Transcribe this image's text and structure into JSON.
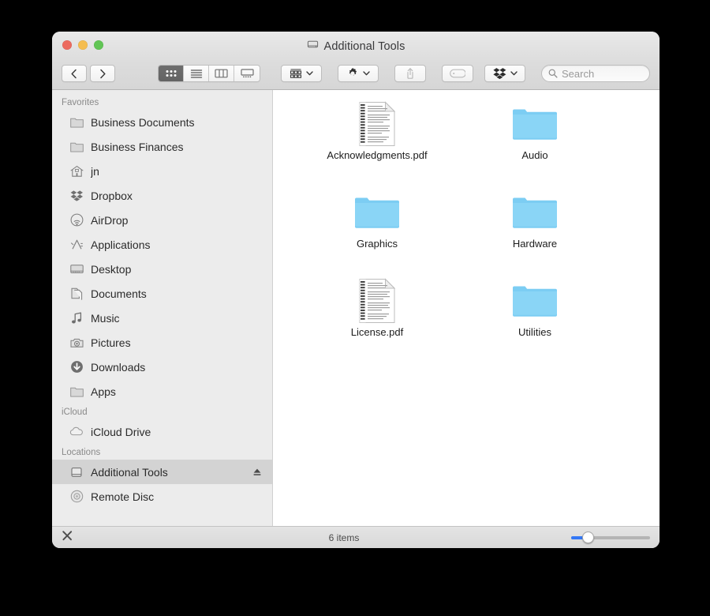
{
  "window": {
    "title": "Additional Tools",
    "title_icon": "external-drive-icon",
    "traffic_lights": {
      "close_label": "Close",
      "minimize_label": "Minimize",
      "zoom_label": "Zoom",
      "close_color": "#ec6a5f",
      "minimize_color": "#f4bd50",
      "zoom_color": "#61c555"
    }
  },
  "toolbar": {
    "back_label": "Back",
    "forward_label": "Forward",
    "view_modes": [
      {
        "name": "icon-view",
        "label": "Icon View",
        "active": true
      },
      {
        "name": "list-view",
        "label": "List View",
        "active": false
      },
      {
        "name": "column-view",
        "label": "Column View",
        "active": false
      },
      {
        "name": "gallery-view",
        "label": "Gallery View",
        "active": false
      }
    ],
    "arrange_label": "Arrange",
    "action_label": "Action",
    "share_label": "Share",
    "tags_label": "Edit Tags",
    "dropbox_label": "Dropbox",
    "search": {
      "placeholder": "Search",
      "value": ""
    }
  },
  "sidebar": {
    "sections": [
      {
        "header": "Favorites",
        "items": [
          {
            "label": "Business Documents",
            "icon": "folder-icon",
            "selected": false,
            "eject": false
          },
          {
            "label": "Business Finances",
            "icon": "folder-icon",
            "selected": false,
            "eject": false
          },
          {
            "label": "jn",
            "icon": "home-icon",
            "selected": false,
            "eject": false
          },
          {
            "label": "Dropbox",
            "icon": "dropbox-icon",
            "selected": false,
            "eject": false
          },
          {
            "label": "AirDrop",
            "icon": "airdrop-icon",
            "selected": false,
            "eject": false
          },
          {
            "label": "Applications",
            "icon": "applications-icon",
            "selected": false,
            "eject": false
          },
          {
            "label": "Desktop",
            "icon": "desktop-icon",
            "selected": false,
            "eject": false
          },
          {
            "label": "Documents",
            "icon": "documents-icon",
            "selected": false,
            "eject": false
          },
          {
            "label": "Music",
            "icon": "music-note-icon",
            "selected": false,
            "eject": false
          },
          {
            "label": "Pictures",
            "icon": "camera-icon",
            "selected": false,
            "eject": false
          },
          {
            "label": "Downloads",
            "icon": "downloads-icon",
            "selected": false,
            "eject": false
          },
          {
            "label": "Apps",
            "icon": "folder-icon",
            "selected": false,
            "eject": false
          }
        ]
      },
      {
        "header": "iCloud",
        "items": [
          {
            "label": "iCloud Drive",
            "icon": "cloud-icon",
            "selected": false,
            "eject": false
          }
        ]
      },
      {
        "header": "Locations",
        "items": [
          {
            "label": "Additional Tools",
            "icon": "external-drive-icon",
            "selected": true,
            "eject": true
          },
          {
            "label": "Remote Disc",
            "icon": "optical-disc-icon",
            "selected": false,
            "eject": false
          }
        ]
      }
    ]
  },
  "content": {
    "items": [
      {
        "label": "Acknowledgments.pdf",
        "type": "pdf",
        "icon": "pdf-document-icon"
      },
      {
        "label": "Audio",
        "type": "folder",
        "icon": "folder-icon"
      },
      {
        "label": "Graphics",
        "type": "folder",
        "icon": "folder-icon"
      },
      {
        "label": "Hardware",
        "type": "folder",
        "icon": "folder-icon"
      },
      {
        "label": "License.pdf",
        "type": "pdf",
        "icon": "pdf-document-icon"
      },
      {
        "label": "Utilities",
        "type": "folder",
        "icon": "folder-icon"
      }
    ],
    "folder_color": "#7acdf2"
  },
  "statusbar": {
    "item_count_text": "6 items",
    "tags_icon": "marker-pen-icon",
    "zoom_slider": {
      "value": 16,
      "min": 0,
      "max": 100,
      "fill_color": "#3478f6"
    }
  }
}
